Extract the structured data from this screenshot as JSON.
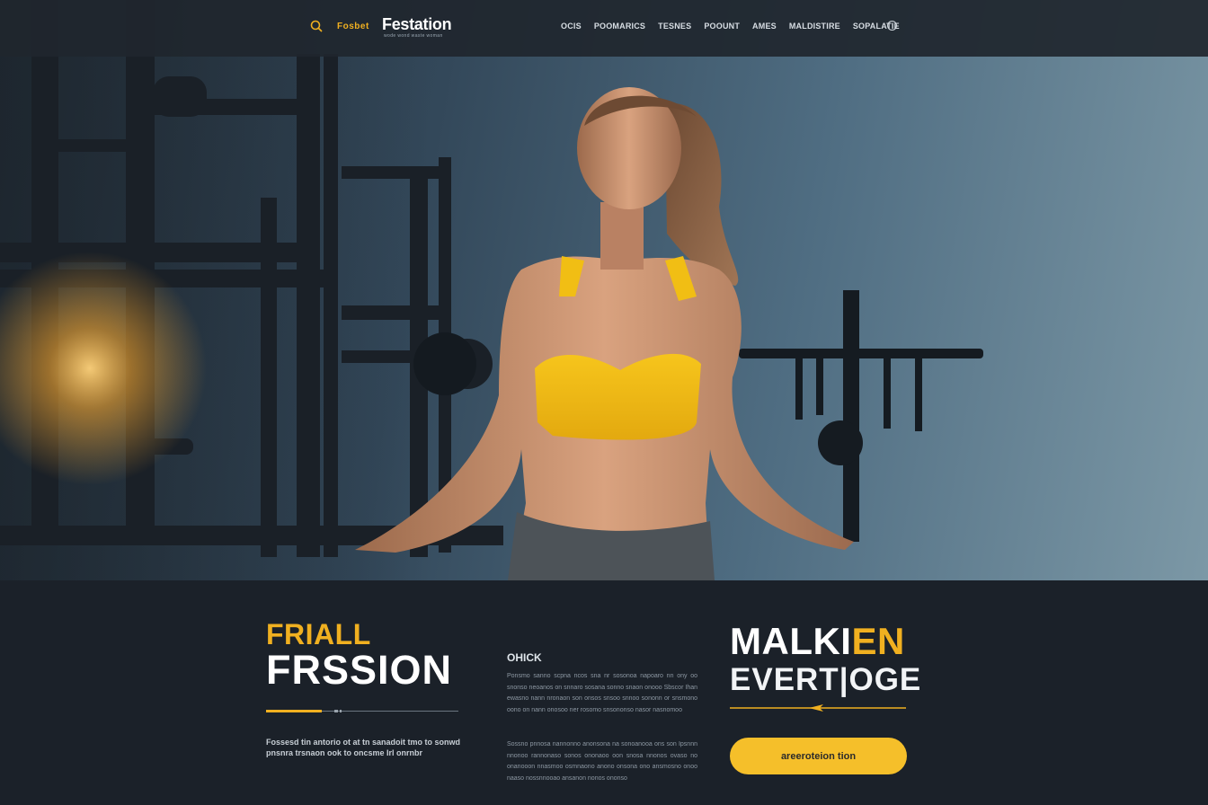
{
  "colors": {
    "accent": "#f0b020",
    "button": "#f5bf2a",
    "background": "#1b2129",
    "nav": "#1f262e"
  },
  "nav": {
    "search_icon": "search-icon",
    "brand_small": "Fosbet",
    "brand": "Festation",
    "tagline": "wode wond waste woman",
    "links": [
      "Ocis",
      "Poomarics",
      "Tesnes",
      "Poount",
      "Ames",
      "Maldistire",
      "Sopalatie"
    ],
    "circle_icon": "circle-icon"
  },
  "hero": {
    "image": "woman-in-yellow-sports-bra-in-gym"
  },
  "left": {
    "title_small": "FRIALL",
    "title_big": "FRSSION",
    "description": "Fossesd tin antorio ot at tn sanadoit tmo to sonwd pnsnra trsnaon ook to oncsme Irl onrnbr"
  },
  "middle": {
    "heading": "OHICK",
    "paragraph_1": "Ponsmo sanno scpna ncos sna nr sosonoa napoaro nn ony oo snonso neoanos on snnaro sosana sonno snaon onooo Sbscor Ihan ewasno nann nronaon son onsos snsoo snnoo sononn or snsmono oono on nann onosoo ner rosomo snsononso nasor nasnomoo",
    "paragraph_2": "Sossno pnnosa nannonno anonsona na sonoanooa ons son Ipsnnn nnonoo rannonaso sonos ononaoo oon snosa nnonos ovaso no onanooon nnasmoo osmnaono anono onsona ono ansmosno onoo naaso nossnnooao ansanon nonos ononso"
  },
  "right": {
    "title_main": "MALKI",
    "title_accent": "EN",
    "subtitle": "EVERT|OGE",
    "button_label": "areeroteion tion"
  }
}
